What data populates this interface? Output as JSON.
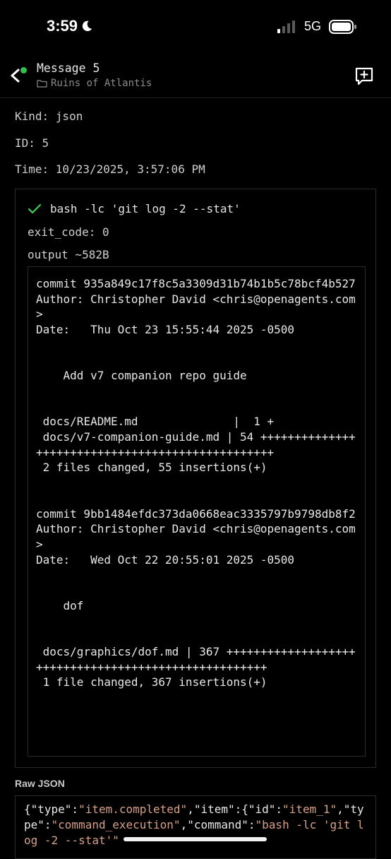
{
  "status_bar": {
    "time": "3:59",
    "network": "5G"
  },
  "header": {
    "title": "Message 5",
    "subtitle": "Ruins of Atlantis"
  },
  "meta": {
    "kind": "Kind: json",
    "id": "ID: 5",
    "time": "Time: 10/23/2025, 3:57:06 PM"
  },
  "tool_call": {
    "command": "bash -lc 'git log -2 --stat'",
    "exit_code": "exit_code: 0",
    "output_label": "output ~582B",
    "output": "commit 935a849c17f8c5a3309d31b74b1b5c78bcf4b527\nAuthor: Christopher David <chris@openagents.com>\nDate:   Thu Oct 23 15:55:44 2025 -0500\n\n\n    Add v7 companion repo guide\n\n\n docs/README.md              |  1 +\n docs/v7-companion-guide.md | 54 +++++++++++++++++++++++++++++++++++++++++++++++++\n 2 files changed, 55 insertions(+)\n\n\ncommit 9bb1484efdc373da0668eac3335797b9798db8f2\nAuthor: Christopher David <chris@openagents.com>\nDate:   Wed Oct 22 20:55:01 2025 -0500\n\n\n    dof\n\n\n docs/graphics/dof.md | 367 +++++++++++++++++++++++++++++++++++++++++++++++++++++\n 1 file changed, 367 insertions(+)"
  },
  "raw_json": {
    "label": "Raw JSON",
    "tokens": [
      {
        "t": "{\"type\":",
        "s": false
      },
      {
        "t": "\"item.completed\"",
        "s": true
      },
      {
        "t": ",\"item\":{\"id\":",
        "s": false
      },
      {
        "t": "\"item_1\"",
        "s": true
      },
      {
        "t": ",\"type\":",
        "s": false
      },
      {
        "t": "\"command_execution\"",
        "s": true
      },
      {
        "t": ",\"command\":",
        "s": false
      },
      {
        "t": "\"bash -lc 'git log -2 --stat'\"",
        "s": true
      }
    ]
  },
  "colors": {
    "online": "#2fc24c",
    "check": "#3ecf5a",
    "json_string": "#d7a088"
  }
}
